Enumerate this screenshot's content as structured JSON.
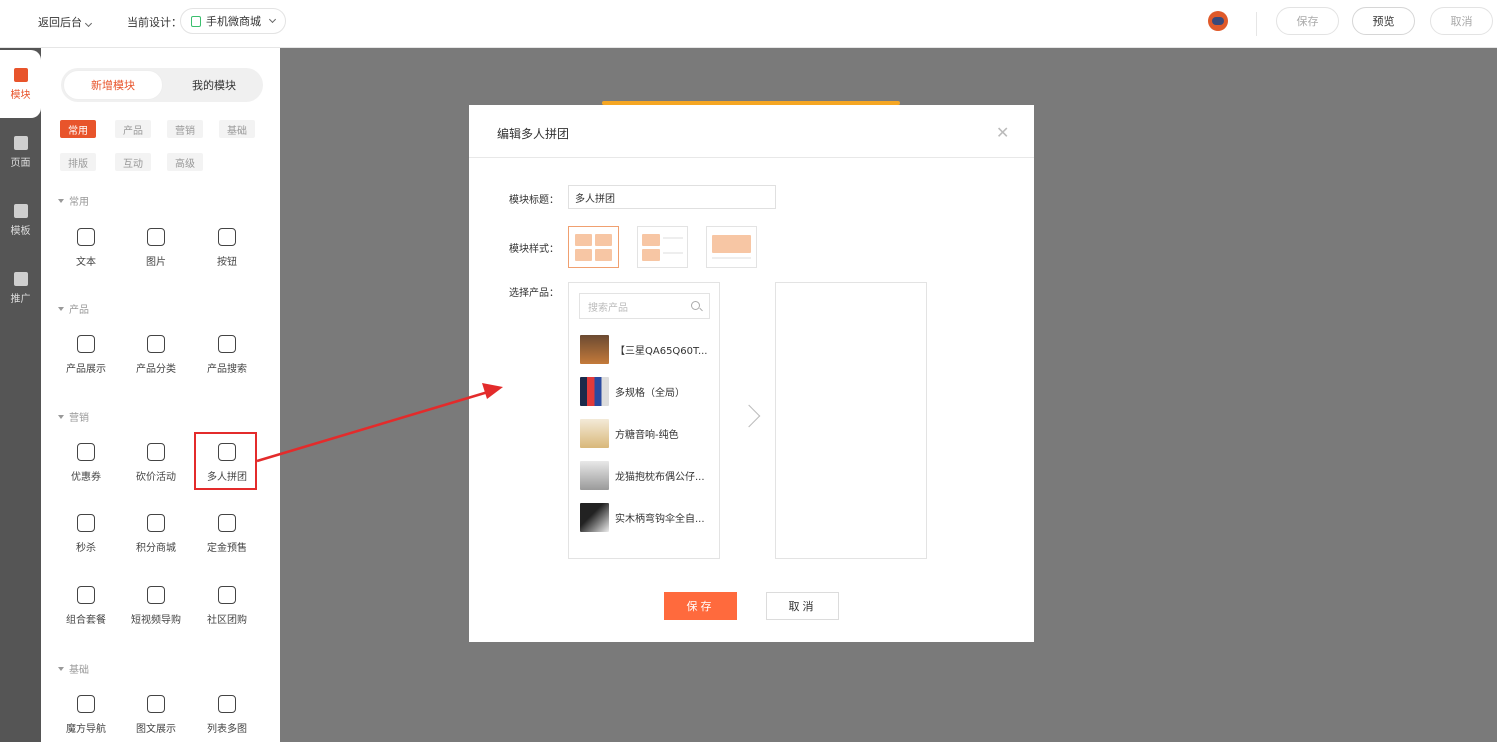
{
  "topbar": {
    "back_label": "返回后台",
    "current_design_label": "当前设计：",
    "design_name": "手机微商城",
    "save_label": "保存",
    "preview_label": "预览",
    "cancel_label": "取消"
  },
  "rail": {
    "items": [
      {
        "label": "模块",
        "icon": "module-icon"
      },
      {
        "label": "页面",
        "icon": "page-icon"
      },
      {
        "label": "模板",
        "icon": "template-icon"
      },
      {
        "label": "推广",
        "icon": "megaphone-icon"
      }
    ]
  },
  "panel": {
    "tabs": [
      "新增模块",
      "我的模块"
    ],
    "chips": [
      "常用",
      "产品",
      "营销",
      "基础",
      "排版",
      "互动",
      "高级"
    ],
    "sections": {
      "common": {
        "title": "常用",
        "items": [
          "文本",
          "图片",
          "按钮"
        ]
      },
      "product": {
        "title": "产品",
        "items": [
          "产品展示",
          "产品分类",
          "产品搜索"
        ]
      },
      "marketing": {
        "title": "营销",
        "items": [
          "优惠券",
          "砍价活动",
          "多人拼团",
          "秒杀",
          "积分商城",
          "定金预售",
          "组合套餐",
          "短视频导购",
          "社区团购"
        ]
      },
      "basic": {
        "title": "基础",
        "items": [
          "魔方导航",
          "图文展示",
          "列表多图"
        ]
      }
    }
  },
  "dialog": {
    "title": "编辑多人拼团",
    "title_label": "模块标题：",
    "title_value": "多人拼团",
    "style_label": "模块样式：",
    "product_label": "选择产品：",
    "search_placeholder": "搜索产品",
    "products": [
      "【三星QA65Q60T...",
      "多规格（全局）",
      "方糖音响-纯色",
      "龙猫抱枕布偶公仔...",
      "实木柄弯钩伞全自..."
    ],
    "save_label": "保存",
    "cancel_label": "取消"
  },
  "colors": {
    "accent": "#e8542b",
    "highlight": "#e32b2b",
    "save_button": "#ff6a3d"
  }
}
